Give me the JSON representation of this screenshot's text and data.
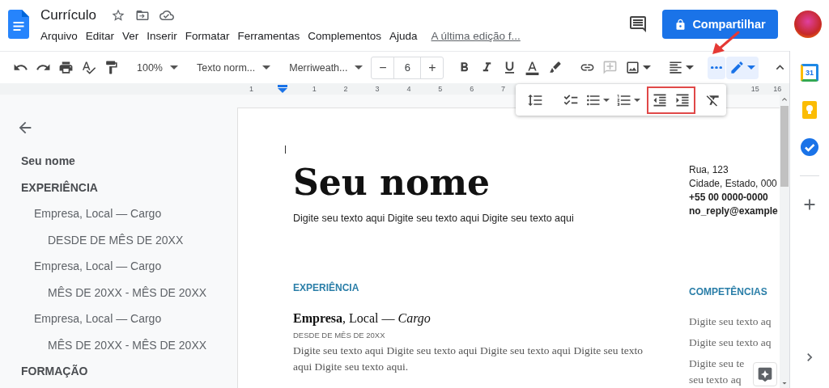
{
  "header": {
    "title": "Currículo",
    "menu": [
      "Arquivo",
      "Editar",
      "Ver",
      "Inserir",
      "Formatar",
      "Ferramentas",
      "Complementos",
      "Ajuda"
    ],
    "last_edit": "A última edição f...",
    "share_label": "Compartilhar"
  },
  "toolbar": {
    "items": [
      {
        "kind": "undo"
      },
      {
        "kind": "redo"
      },
      {
        "kind": "print"
      },
      {
        "kind": "spellcheck"
      },
      {
        "kind": "paint-format"
      },
      {
        "kind": "separator"
      },
      {
        "kind": "dropdown",
        "label": "100%"
      },
      {
        "kind": "separator"
      },
      {
        "kind": "dropdown",
        "label": "Texto norm..."
      },
      {
        "kind": "separator"
      },
      {
        "kind": "dropdown",
        "label": "Merriweath..."
      },
      {
        "kind": "stepper",
        "minus": "−",
        "value": "6",
        "plus": "+"
      },
      {
        "kind": "separator"
      },
      {
        "kind": "bold"
      },
      {
        "kind": "italic"
      },
      {
        "kind": "underline"
      },
      {
        "kind": "text-color"
      },
      {
        "kind": "highlight"
      },
      {
        "kind": "separator"
      },
      {
        "kind": "link"
      },
      {
        "kind": "comment",
        "disabled": true
      },
      {
        "kind": "image"
      },
      {
        "kind": "separator"
      },
      {
        "kind": "align"
      },
      {
        "kind": "separator"
      },
      {
        "kind": "more",
        "selected": true,
        "arrow": true
      },
      {
        "kind": "pen",
        "selected": true
      },
      {
        "kind": "separator"
      },
      {
        "kind": "collapse"
      }
    ]
  },
  "overflow_toolbar": {
    "groups": [
      {
        "highlighted": false,
        "items": [
          {
            "kind": "line-spacing"
          }
        ]
      },
      {
        "kind": "separator"
      },
      {
        "highlighted": false,
        "items": [
          {
            "kind": "checklist"
          },
          {
            "kind": "bullets"
          },
          {
            "kind": "numbered"
          }
        ]
      },
      {
        "highlighted": true,
        "items": [
          {
            "kind": "indent-less"
          },
          {
            "kind": "indent-more"
          }
        ]
      },
      {
        "highlighted": false,
        "items": [
          {
            "kind": "clear-format"
          }
        ]
      }
    ]
  },
  "ruler": {
    "labels": [
      "1",
      "1",
      "2",
      "3",
      "4",
      "5",
      "6",
      "7",
      "15",
      "16"
    ]
  },
  "outline": {
    "items": [
      {
        "text": "Seu nome"
      },
      {
        "text": "EXPERIÊNCIA",
        "children": [
          {
            "text": "Empresa, Local — Cargo",
            "children": [
              {
                "text": "DESDE DE MÊS DE 20XX"
              }
            ]
          },
          {
            "text": "Empresa, Local — Cargo",
            "children": [
              {
                "text": "MÊS DE 20XX - MÊS DE 20XX"
              }
            ]
          },
          {
            "text": "Empresa, Local — Cargo",
            "children": [
              {
                "text": "MÊS DE 20XX - MÊS DE 20XX"
              }
            ]
          }
        ]
      },
      {
        "text": "FORMAÇÃO"
      }
    ]
  },
  "document": {
    "name": "Seu nome",
    "tagline": "Digite seu texto aqui Digite seu texto aqui Digite seu texto aqui",
    "contact": [
      {
        "text": "Rua, 123",
        "bold": false
      },
      {
        "text": "Cidade, Estado, 000",
        "bold": false
      },
      {
        "text": "+55 00 0000-0000",
        "bold": true
      },
      {
        "text": "no_reply@example",
        "bold": true
      }
    ],
    "experience": {
      "heading": "EXPERIÊNCIA",
      "job": "**Empresa**, Local — *Cargo*",
      "dates": "DESDE DE MÊS DE 20XX",
      "description": "Digite seu texto aqui Digite seu texto aqui Digite seu texto aqui Digite seu texto aqui Digite seu texto aqui."
    },
    "skills": {
      "heading": "COMPETÊNCIAS",
      "items": [
        {
          "lines": [
            "Digite seu texto aq"
          ]
        },
        {
          "lines": [
            "Digite seu texto aq"
          ]
        },
        {
          "lines": [
            "Digite seu te",
            "seu texto aq"
          ]
        }
      ]
    }
  },
  "side_panel": {
    "items": [
      {
        "kind": "calendar",
        "label": "31"
      },
      {
        "kind": "keep"
      },
      {
        "kind": "tasks"
      },
      {
        "kind": "divider"
      },
      {
        "kind": "add"
      }
    ]
  }
}
